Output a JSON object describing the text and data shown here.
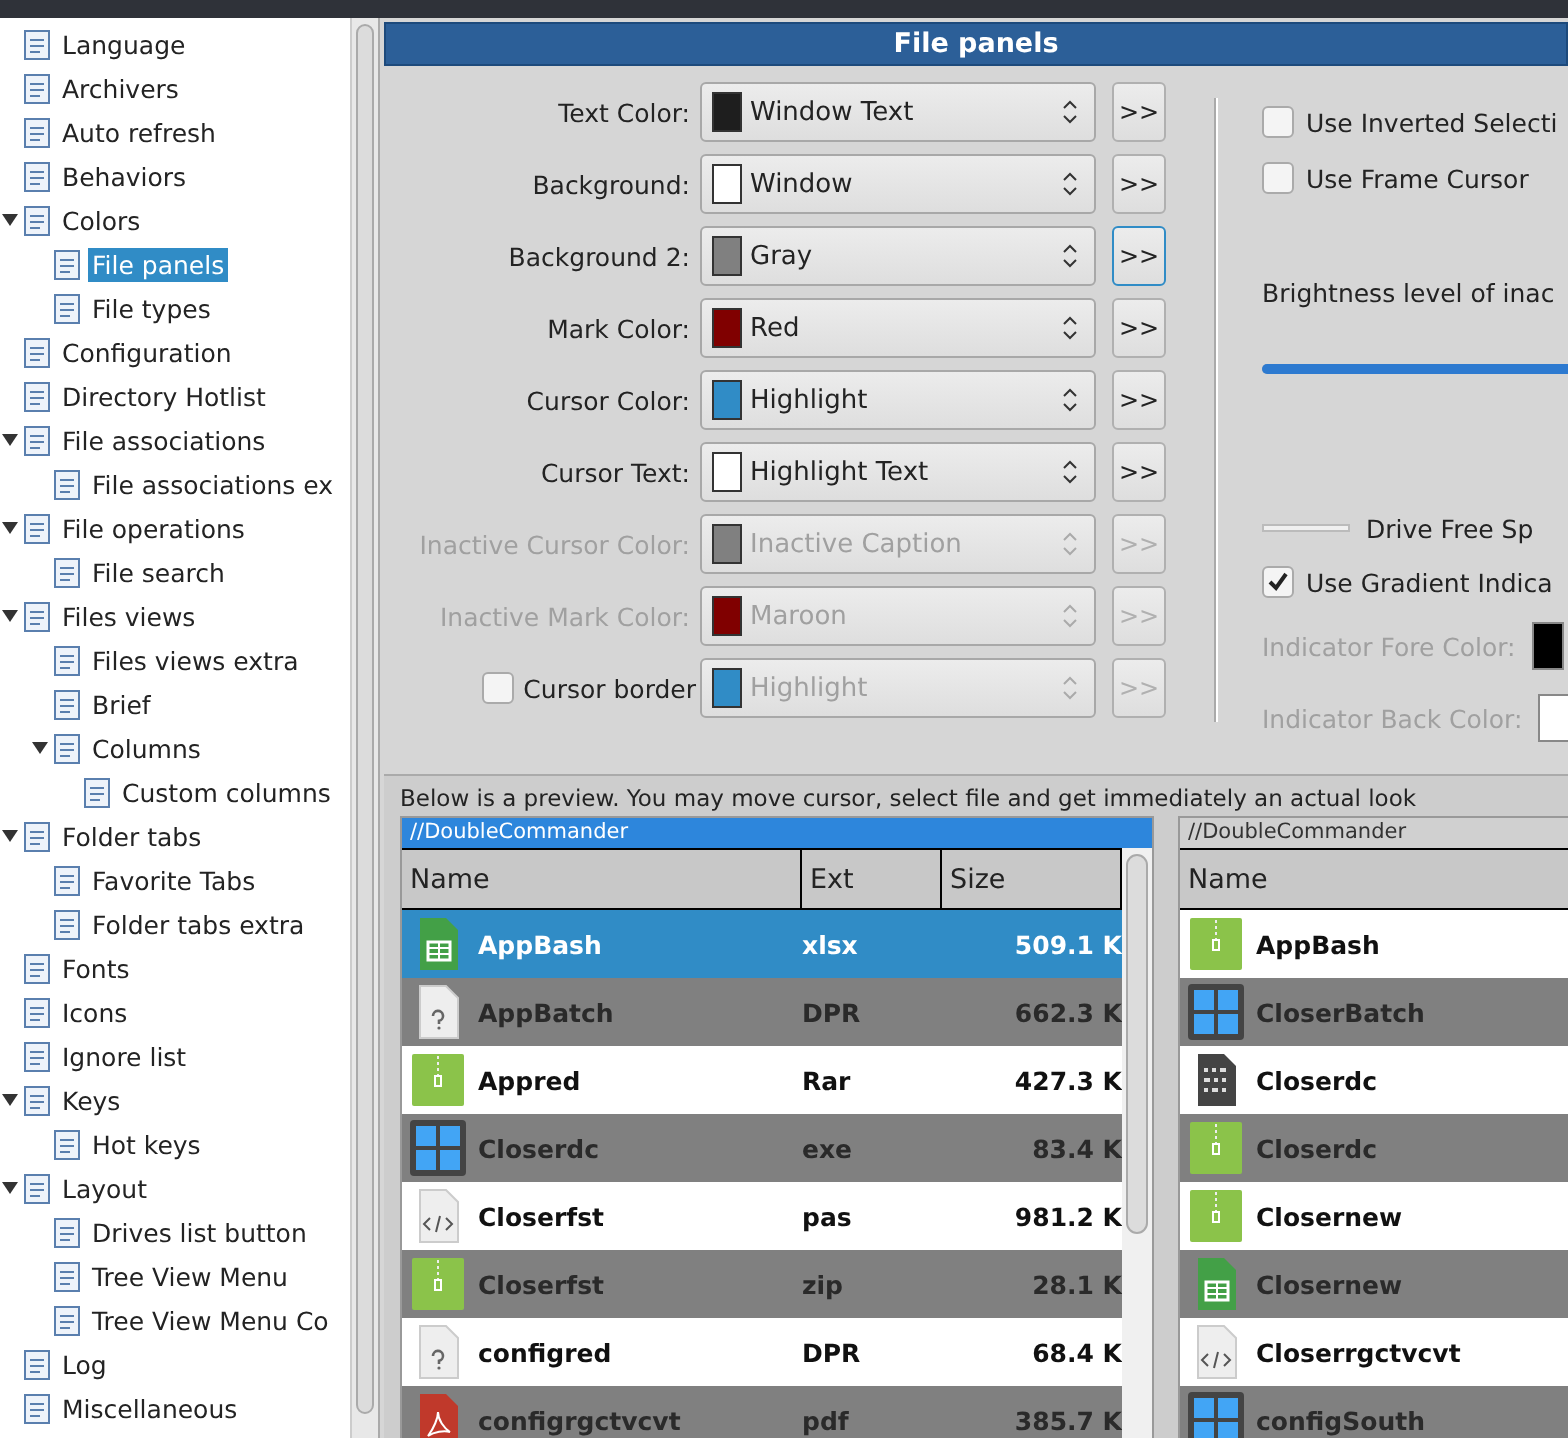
{
  "tree": [
    {
      "label": "Language",
      "selected": false
    },
    {
      "label": "Archivers",
      "selected": false
    },
    {
      "label": "Auto refresh",
      "selected": false
    },
    {
      "label": "Behaviors",
      "selected": false
    },
    {
      "label": "Colors",
      "selected": false,
      "expanded": true,
      "children": [
        {
          "label": "File panels",
          "selected": true
        },
        {
          "label": "File types",
          "selected": false
        }
      ]
    },
    {
      "label": "Configuration",
      "selected": false
    },
    {
      "label": "Directory Hotlist",
      "selected": false
    },
    {
      "label": "File associations",
      "selected": false,
      "expanded": true,
      "children": [
        {
          "label": "File associations ex",
          "selected": false
        }
      ]
    },
    {
      "label": "File operations",
      "selected": false,
      "expanded": true,
      "children": [
        {
          "label": "File search",
          "selected": false
        }
      ]
    },
    {
      "label": "Files views",
      "selected": false,
      "expanded": true,
      "children": [
        {
          "label": "Files views extra",
          "selected": false
        },
        {
          "label": "Brief",
          "selected": false
        },
        {
          "label": "Columns",
          "selected": false,
          "expanded": true,
          "children": [
            {
              "label": "Custom columns",
              "selected": false
            }
          ]
        }
      ]
    },
    {
      "label": "Folder tabs",
      "selected": false,
      "expanded": true,
      "children": [
        {
          "label": "Favorite Tabs",
          "selected": false
        },
        {
          "label": "Folder tabs extra",
          "selected": false
        }
      ]
    },
    {
      "label": "Fonts",
      "selected": false
    },
    {
      "label": "Icons",
      "selected": false
    },
    {
      "label": "Ignore list",
      "selected": false
    },
    {
      "label": "Keys",
      "selected": false,
      "expanded": true,
      "children": [
        {
          "label": "Hot keys",
          "selected": false
        }
      ]
    },
    {
      "label": "Layout",
      "selected": false,
      "expanded": true,
      "children": [
        {
          "label": "Drives list button",
          "selected": false
        },
        {
          "label": "Tree View Menu",
          "selected": false
        },
        {
          "label": "Tree View Menu Co",
          "selected": false
        }
      ]
    },
    {
      "label": "Log",
      "selected": false
    },
    {
      "label": "Miscellaneous",
      "selected": false
    }
  ],
  "header": "File panels",
  "color_rows": [
    {
      "label": "Text Color:",
      "value": "Window Text",
      "color": "#1e1e1e",
      "button": ">>",
      "disabled": false
    },
    {
      "label": "Background:",
      "value": "Window",
      "color": "#ffffff",
      "button": ">>",
      "disabled": false
    },
    {
      "label": "Background 2:",
      "value": "Gray",
      "color": "#808080",
      "button": ">>",
      "disabled": false,
      "focused": true
    },
    {
      "label": "Mark Color:",
      "value": "Red",
      "color": "#800000",
      "button": ">>",
      "disabled": false
    },
    {
      "label": "Cursor Color:",
      "value": "Highlight",
      "color": "#308cc6",
      "button": ">>",
      "disabled": false
    },
    {
      "label": "Cursor Text:",
      "value": "Highlight Text",
      "color": "#ffffff",
      "button": ">>",
      "disabled": false
    },
    {
      "label": "Inactive Cursor Color:",
      "value": "Inactive Caption",
      "color": "#808080",
      "button": ">>",
      "disabled": true
    },
    {
      "label": "Inactive Mark Color:",
      "value": "Maroon",
      "color": "#800000",
      "button": ">>",
      "disabled": true
    },
    {
      "label": "Cursor border",
      "value": "Highlight",
      "color": "#308cc6",
      "button": ">>",
      "disabled": true,
      "checked": false
    }
  ],
  "options": {
    "inverted_selection": {
      "label": "Use Inverted Selecti",
      "checked": false
    },
    "frame_cursor": {
      "label": "Use Frame Cursor",
      "checked": false
    },
    "brightness": {
      "label": "Brightness level of inac",
      "level": 1
    },
    "drive_free_space": "Drive Free Sp",
    "gradient": {
      "label": "Use Gradient Indica",
      "checked": true
    },
    "fore_color": {
      "label": "Indicator Fore Color:",
      "color": "#000000",
      "disabled": true
    },
    "back_color": {
      "label": "Indicator Back Color:",
      "color": "#ffffff",
      "disabled": true
    }
  },
  "preview_note": "Below is a preview. You may move cursor, select file and get immediately an actual look",
  "left_panel": {
    "path": "//DoubleCommander",
    "active": true,
    "columns": [
      "Name",
      "Ext",
      "Size"
    ],
    "rows": [
      {
        "kind": "spreadsheet",
        "name": "AppBash",
        "ext": "xlsx",
        "size": "509.1 K",
        "selected": true
      },
      {
        "kind": "unknown",
        "name": "AppBatch",
        "ext": "DPR",
        "size": "662.3 K",
        "selected": false
      },
      {
        "kind": "archive",
        "name": "Appred",
        "ext": "Rar",
        "size": "427.3 K",
        "selected": false
      },
      {
        "kind": "executable",
        "name": "Closerdc",
        "ext": "exe",
        "size": "83.4 K",
        "selected": false
      },
      {
        "kind": "code",
        "name": "Closerfst",
        "ext": "pas",
        "size": "981.2 K",
        "selected": false
      },
      {
        "kind": "archive",
        "name": "Closerfst",
        "ext": "zip",
        "size": "28.1 K",
        "selected": false
      },
      {
        "kind": "unknown",
        "name": "configred",
        "ext": "DPR",
        "size": "68.4 K",
        "selected": false
      },
      {
        "kind": "pdf",
        "name": "configrgctvcvt",
        "ext": "pdf",
        "size": "385.7 K",
        "selected": false
      }
    ]
  },
  "right_panel": {
    "path": "//DoubleCommander",
    "active": false,
    "columns": [
      "Name"
    ],
    "rows": [
      {
        "kind": "archive",
        "name": "AppBash",
        "selected": false
      },
      {
        "kind": "executable",
        "name": "CloserBatch",
        "selected": false
      },
      {
        "kind": "binary",
        "name": "Closerdc",
        "selected": false
      },
      {
        "kind": "archive",
        "name": "Closerdc",
        "selected": false
      },
      {
        "kind": "archive",
        "name": "Closernew",
        "selected": false
      },
      {
        "kind": "spreadsheet",
        "name": "Closernew",
        "selected": false
      },
      {
        "kind": "code",
        "name": "Closerrgctvcvt",
        "selected": false
      },
      {
        "kind": "executable",
        "name": "configSouth",
        "selected": false
      }
    ]
  }
}
